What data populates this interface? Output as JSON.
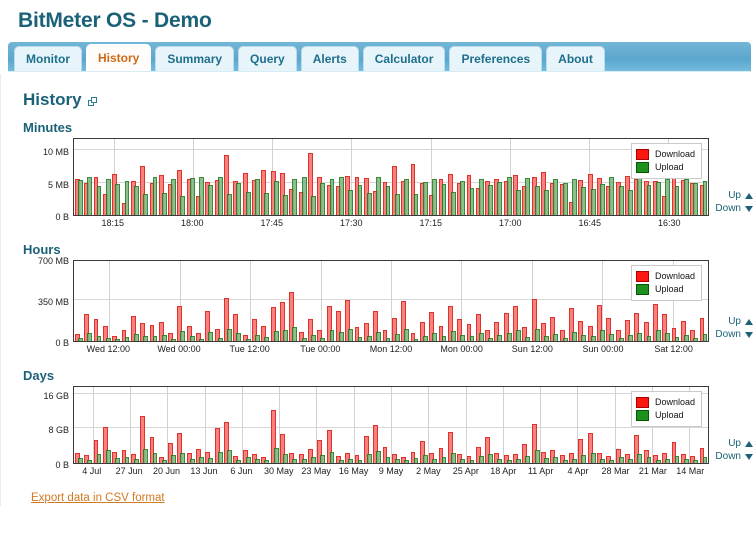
{
  "app": {
    "title": "BitMeter OS - Demo"
  },
  "tabs": [
    {
      "label": "Monitor",
      "active": false
    },
    {
      "label": "History",
      "active": true
    },
    {
      "label": "Summary",
      "active": false
    },
    {
      "label": "Query",
      "active": false
    },
    {
      "label": "Alerts",
      "active": false
    },
    {
      "label": "Calculator",
      "active": false
    },
    {
      "label": "Preferences",
      "active": false
    },
    {
      "label": "About",
      "active": false
    }
  ],
  "page": {
    "heading": "History",
    "popout_icon": "popout-icon"
  },
  "legend": {
    "download_label": "Download",
    "upload_label": "Upload",
    "download_color": "#fb1612",
    "upload_color": "#1e901e"
  },
  "scroll_controls": {
    "up_label": "Up",
    "down_label": "Down",
    "up_icon": "triangle-up-icon",
    "down_icon": "triangle-down-icon"
  },
  "footer": {
    "csv_link": "Export data in CSV format"
  },
  "charts": [
    {
      "title": "Minutes",
      "yticks": [
        "10 MB",
        "5 MB",
        "0 B"
      ],
      "xticks": [
        "18:15",
        "18:00",
        "17:45",
        "17:30",
        "17:15",
        "17:00",
        "16:45",
        "16:30"
      ]
    },
    {
      "title": "Hours",
      "yticks": [
        "700 MB",
        "350 MB",
        "0 B"
      ],
      "xticks": [
        "Wed 12:00",
        "Wed 00:00",
        "Tue 12:00",
        "Tue 00:00",
        "Mon 12:00",
        "Mon 00:00",
        "Sun 12:00",
        "Sun 00:00",
        "Sat 12:00"
      ]
    },
    {
      "title": "Days",
      "yticks": [
        "16 GB",
        "8 GB",
        "0 B"
      ],
      "xticks": [
        "4 Jul",
        "27 Jun",
        "20 Jun",
        "13 Jun",
        "6 Jun",
        "30 May",
        "23 May",
        "16 May",
        "9 May",
        "2 May",
        "25 Apr",
        "18 Apr",
        "11 Apr",
        "4 Apr",
        "28 Mar",
        "21 Mar",
        "14 Mar"
      ]
    }
  ],
  "chart_data": [
    {
      "type": "bar",
      "title": "Minutes",
      "xlabel": "",
      "ylabel": "",
      "ylim": [
        0,
        12
      ],
      "yunit": "MB",
      "yticks": [
        0,
        5,
        10
      ],
      "ytick_labels": [
        "0 B",
        "5 MB",
        "10 MB"
      ],
      "xtick_labels": [
        "18:15",
        "18:00",
        "17:45",
        "17:30",
        "17:15",
        "17:00",
        "16:45",
        "16:30"
      ],
      "grid": true,
      "legend": [
        "Download",
        "Upload"
      ],
      "legend_position": "top-right",
      "series": [
        {
          "name": "Download",
          "color": "#f4827f",
          "values": [
            5.6,
            5.0,
            5.9,
            3.3,
            6.3,
            1.8,
            5.2,
            7.5,
            5.0,
            6.1,
            4.8,
            7.0,
            5.5,
            2.9,
            5.1,
            5.4,
            9.2,
            5.2,
            6.4,
            5.4,
            6.9,
            6.7,
            6.5,
            4.0,
            3.6,
            9.5,
            5.8,
            4.6,
            4.4,
            6.0,
            5.9,
            5.7,
            3.7,
            5.1,
            7.6,
            5.3,
            7.8,
            4.9,
            3.1,
            5.6,
            6.3,
            5.0,
            6.1,
            4.2,
            5.2,
            5.6,
            5.2,
            6.1,
            4.5,
            5.9,
            6.6,
            5.0,
            4.8,
            2.0,
            5.4,
            6.3,
            5.7,
            4.5,
            5.1,
            6.0,
            5.6,
            5.3,
            5.2,
            3.0,
            5.7,
            5.4,
            5.0,
            4.6
          ]
        },
        {
          "name": "Upload",
          "color": "#7fb77f",
          "values": [
            5.4,
            5.9,
            4.4,
            5.6,
            4.7,
            5.2,
            4.5,
            3.2,
            5.8,
            3.4,
            5.5,
            3.0,
            5.7,
            5.9,
            4.6,
            5.9,
            3.2,
            4.9,
            3.6,
            5.6,
            3.4,
            5.2,
            3.1,
            5.6,
            5.8,
            3.0,
            4.9,
            5.6,
            5.8,
            3.9,
            4.6,
            3.4,
            5.8,
            4.5,
            3.3,
            5.5,
            3.2,
            5.1,
            5.6,
            4.7,
            3.5,
            5.3,
            4.2,
            5.5,
            4.6,
            5.1,
            5.8,
            3.8,
            5.7,
            4.4,
            3.9,
            5.6,
            5.0,
            5.6,
            4.3,
            4.0,
            4.8,
            5.9,
            4.4,
            3.8,
            6.2,
            4.6,
            5.1,
            5.6,
            4.4,
            5.6,
            5.0,
            5.2
          ]
        }
      ]
    },
    {
      "type": "bar",
      "title": "Hours",
      "xlabel": "",
      "ylabel": "",
      "ylim": [
        0,
        700
      ],
      "yunit": "MB",
      "yticks": [
        0,
        350,
        700
      ],
      "ytick_labels": [
        "0 B",
        "350 MB",
        "700 MB"
      ],
      "xtick_labels": [
        "Wed 12:00",
        "Wed 00:00",
        "Tue 12:00",
        "Tue 00:00",
        "Mon 12:00",
        "Mon 00:00",
        "Sun 12:00",
        "Sun 00:00",
        "Sat 12:00"
      ],
      "grid": true,
      "legend": [
        "Download",
        "Upload"
      ],
      "legend_position": "top-right",
      "series": [
        {
          "name": "Download",
          "color": "#f4827f",
          "values": [
            60,
            230,
            185,
            130,
            40,
            95,
            215,
            150,
            140,
            160,
            70,
            300,
            130,
            65,
            255,
            105,
            365,
            230,
            50,
            190,
            125,
            290,
            330,
            420,
            80,
            185,
            95,
            300,
            260,
            350,
            120,
            155,
            260,
            95,
            200,
            340,
            70,
            160,
            250,
            130,
            300,
            190,
            145,
            230,
            95,
            165,
            240,
            300,
            120,
            360,
            150,
            205,
            90,
            280,
            170,
            130,
            310,
            200,
            95,
            180,
            240,
            160,
            320,
            230,
            110,
            175,
            90,
            200
          ]
        },
        {
          "name": "Upload",
          "color": "#7fb77f",
          "values": [
            25,
            70,
            45,
            30,
            15,
            35,
            60,
            45,
            40,
            50,
            20,
            85,
            40,
            20,
            75,
            30,
            105,
            70,
            15,
            55,
            35,
            85,
            95,
            120,
            25,
            55,
            30,
            90,
            75,
            100,
            35,
            45,
            75,
            30,
            60,
            100,
            20,
            45,
            70,
            40,
            85,
            55,
            40,
            65,
            30,
            50,
            70,
            90,
            35,
            105,
            45,
            60,
            25,
            80,
            50,
            40,
            90,
            60,
            30,
            55,
            70,
            45,
            95,
            65,
            35,
            50,
            25,
            60
          ]
        }
      ]
    },
    {
      "type": "bar",
      "title": "Days",
      "xlabel": "",
      "ylabel": "",
      "ylim": [
        0,
        18
      ],
      "yunit": "GB",
      "yticks": [
        0,
        8,
        16
      ],
      "ytick_labels": [
        "0 B",
        "8 GB",
        "16 GB"
      ],
      "xtick_labels": [
        "4 Jul",
        "27 Jun",
        "20 Jun",
        "13 Jun",
        "6 Jun",
        "30 May",
        "23 May",
        "16 May",
        "9 May",
        "2 May",
        "25 Apr",
        "18 Apr",
        "11 Apr",
        "4 Apr",
        "28 Mar",
        "21 Mar",
        "14 Mar"
      ],
      "grid": true,
      "legend": [
        "Download",
        "Upload"
      ],
      "legend_position": "top-right",
      "series": [
        {
          "name": "Download",
          "color": "#f4827f",
          "values": [
            2.4,
            1.8,
            5.4,
            8.2,
            2.6,
            3.1,
            2.0,
            10.9,
            6.0,
            1.4,
            4.7,
            6.9,
            2.2,
            3.3,
            2.6,
            8.0,
            9.4,
            1.7,
            3.0,
            2.1,
            1.3,
            12.2,
            6.6,
            2.4,
            2.0,
            3.2,
            5.2,
            7.6,
            1.6,
            2.3,
            1.9,
            6.3,
            8.8,
            3.6,
            2.0,
            1.4,
            2.6,
            5.0,
            2.2,
            3.4,
            7.2,
            2.0,
            1.6,
            3.8,
            6.1,
            2.4,
            1.8,
            2.0,
            4.4,
            9.1,
            2.6,
            3.0,
            1.9,
            2.2,
            5.6,
            7.0,
            2.4,
            1.7,
            3.2,
            2.0,
            6.4,
            3.0,
            1.8,
            2.4,
            4.8,
            2.1,
            1.6,
            3.4
          ]
        },
        {
          "name": "Upload",
          "color": "#7fb77f",
          "values": [
            1.1,
            0.8,
            2.0,
            3.0,
            1.1,
            1.3,
            0.9,
            3.3,
            2.2,
            0.6,
            1.8,
            2.4,
            1.0,
            1.4,
            1.1,
            2.6,
            3.0,
            0.7,
            1.3,
            0.9,
            0.6,
            3.4,
            2.1,
            1.0,
            0.9,
            1.4,
            1.9,
            2.5,
            0.7,
            1.0,
            0.8,
            2.0,
            2.8,
            1.5,
            0.9,
            0.6,
            1.1,
            1.8,
            1.0,
            1.4,
            2.3,
            0.9,
            0.7,
            1.6,
            2.0,
            1.0,
            0.8,
            0.9,
            1.7,
            2.9,
            1.1,
            1.3,
            0.8,
            1.0,
            1.9,
            2.2,
            1.0,
            0.7,
            1.4,
            0.9,
            2.1,
            1.3,
            0.8,
            1.0,
            1.7,
            0.9,
            0.7,
            1.5
          ]
        }
      ]
    }
  ]
}
